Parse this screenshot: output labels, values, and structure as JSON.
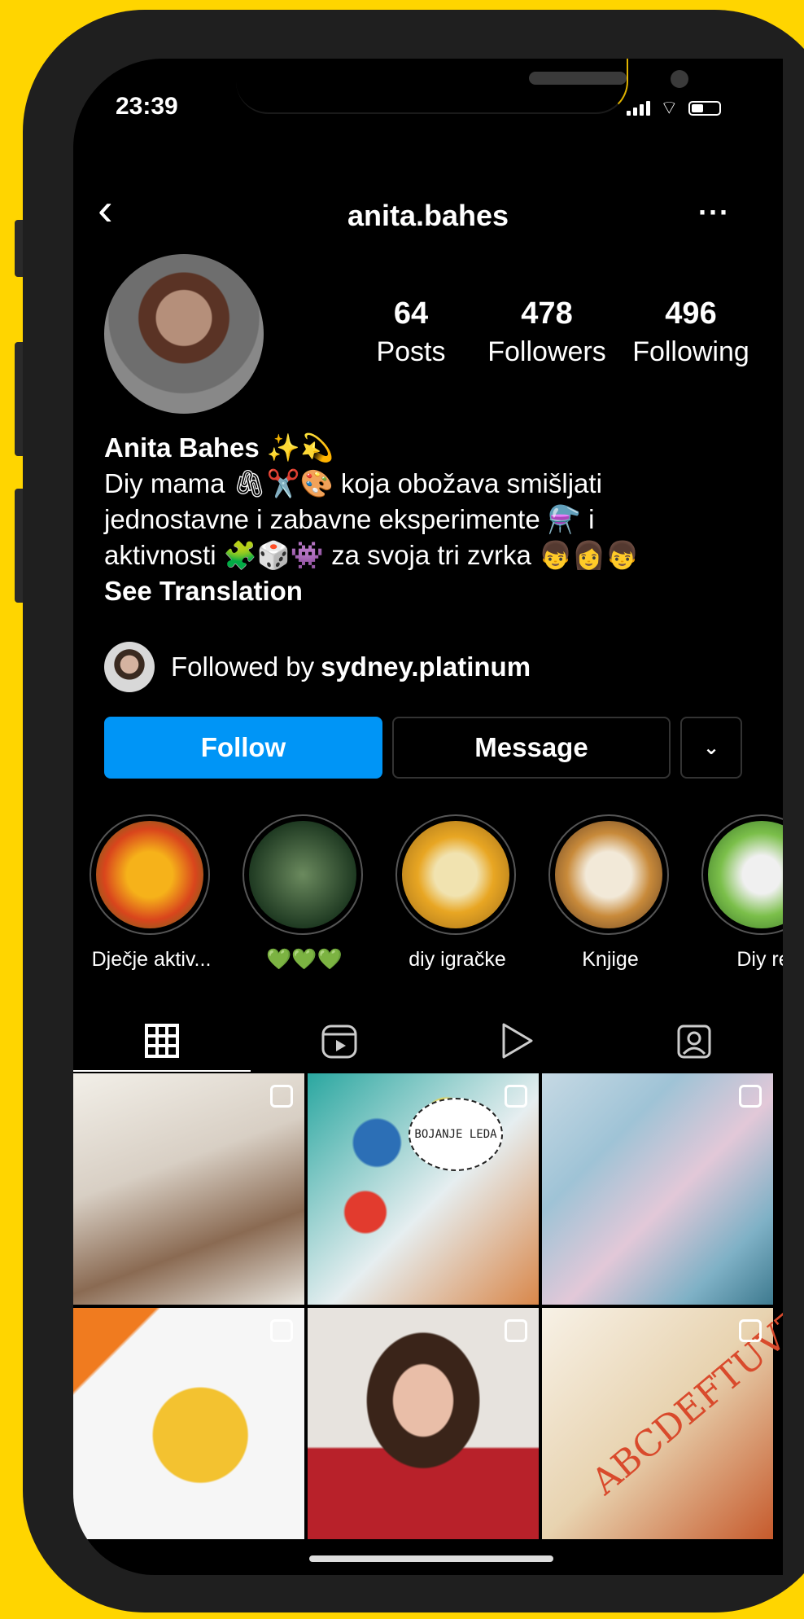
{
  "status_bar": {
    "time": "23:39"
  },
  "profile": {
    "username": "anita.bahes",
    "stats": [
      {
        "num": "64",
        "label": "Posts"
      },
      {
        "num": "478",
        "label": "Followers"
      },
      {
        "num": "496",
        "label": "Following"
      }
    ],
    "name": "Anita Bahes ✨💫",
    "bio_lines": [
      "Diy mama 🖇✂️🎨 koja obožava smišljati",
      "jednostavne i zabavne eksperimente ⚗️ i",
      "aktivnosti 🧩🎲👾 za svoja tri zvrka 👦👩👦"
    ],
    "see_translation": "See Translation",
    "followed_by_prefix": "Followed by",
    "followed_by_user": "sydney.platinum"
  },
  "buttons": {
    "follow": "Follow",
    "message": "Message",
    "dropdown": "⌄"
  },
  "highlights": [
    {
      "label": "Dječje aktiv..."
    },
    {
      "label": "💚💚💚"
    },
    {
      "label": "diy igračke"
    },
    {
      "label": "Knjige"
    },
    {
      "label": "Diy re"
    }
  ],
  "tabs": [
    "grid-icon",
    "reels-icon",
    "video-icon",
    "tagged-icon"
  ],
  "grid_text": {
    "post2": "BOJANJE LEDA",
    "post6": "ABCDEFTUVZ"
  },
  "colors": {
    "follow_blue": "#0095f6",
    "background": "#000000",
    "frame_yellow": "#ffd500"
  }
}
